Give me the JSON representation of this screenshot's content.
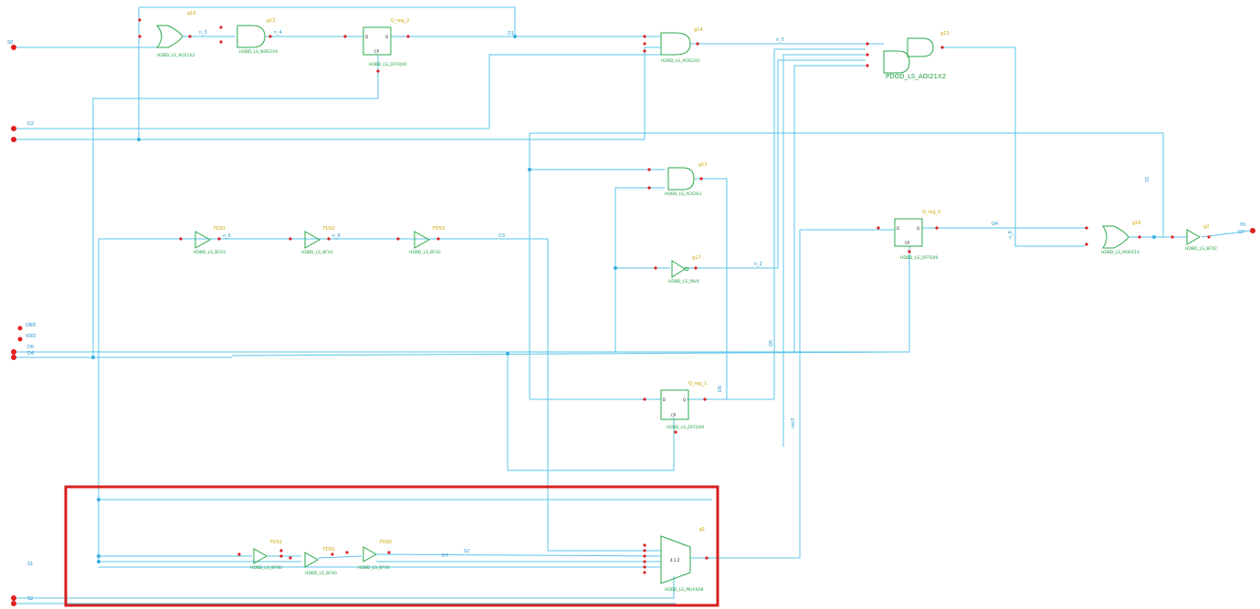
{
  "ports": {
    "in_top": "S0",
    "in_d2": "D2",
    "in_d1": "D1",
    "gnd": "GND",
    "vdd": "VDD",
    "in_d0": "D0",
    "in_d_b": "D4",
    "in_s1": "S1",
    "in_s2": "S2",
    "out_y": "Y0"
  },
  "nets": {
    "n_3": "n_3",
    "n_4": "n_4",
    "n_5": "n_5",
    "n_2": "n_2",
    "n_6": "n_6",
    "n_6b": "n_6",
    "d_net": "D3",
    "net_d1": "D1",
    "net_d2": "D2",
    "net_q": "Q4",
    "net_n1": "n_1",
    "net_mid": "n_7",
    "net_vert1": "SS",
    "net_vert2": "net3",
    "net_vert3": "Q5",
    "net_vert4": "n_8",
    "net_vert5": "D6",
    "net_out": "Q7",
    "net_low": "D7",
    "net_low2": "S2"
  },
  "instances": {
    "g10": "g10",
    "g12": "g12",
    "reg2": "Q_reg_2",
    "g14": "g14",
    "g13": "g13",
    "g11": "g11",
    "g17": "g17",
    "reg0": "Q_reg_0",
    "g16": "g16",
    "g2": "g2",
    "reg1": "Q_reg_1",
    "fd1": "FDS1",
    "fd2": "FDS2",
    "fd3": "FDS3",
    "fd4": "FDS1",
    "fd5": "FDS1",
    "fd6": "FDS0",
    "mux": "g1"
  },
  "cells": {
    "ao": "HDBD_LS_AO21X2",
    "nand": "HDBD_LS_NOR2X4",
    "dff": "HDBD_LS_DFFQX0",
    "aoi": "HDBD_LS_AOI22X2",
    "big": "PDOD_LS_AOI21X2",
    "and3": "HDBD_LS_AOI2X3",
    "inv": "HDBD_LS_INVX",
    "buf1": "HDBD_LS_BFX3",
    "buf2": "HDBD_LS_BFX2",
    "buf3": "HDBD_LS_BFX2",
    "nor": "HDBD_LS_NOR21X",
    "bufout": "HDBD_LS_BFX2",
    "buf4": "HDBD_LS_BFX0",
    "buf5": "HDBD_LS_BFX0",
    "buf6": "HDBD_LS_BFX0",
    "mux": "HDBD_LS_MUX4X8"
  },
  "mux_label": "4:1  Z",
  "colors": {
    "wire": "#5bc4ea",
    "gate": "#2aa84a",
    "pin": "#e02020",
    "instance_label": "#c8a400",
    "highlight": "#d61f1f"
  }
}
